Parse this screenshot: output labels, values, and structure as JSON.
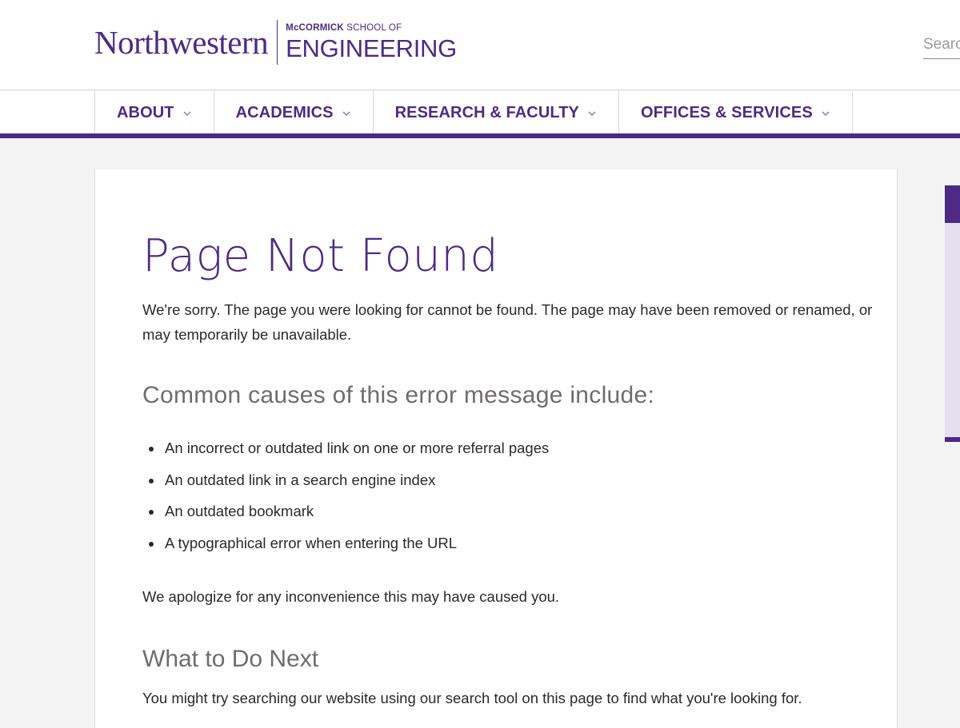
{
  "header": {
    "logo_main": "Northwestern",
    "logo_school_bold": "McCORMICK",
    "logo_school_rest": " SCHOOL OF",
    "logo_school_bottom": "ENGINEERING",
    "search_placeholder": "Search"
  },
  "nav": {
    "items": [
      {
        "label": "ABOUT"
      },
      {
        "label": "ACADEMICS"
      },
      {
        "label": "RESEARCH & FACULTY"
      },
      {
        "label": "OFFICES & SERVICES"
      }
    ]
  },
  "main": {
    "title": "Page Not Found",
    "intro": "We're sorry. The page you were looking for cannot be found. The page may have been removed or renamed, or may temporarily be unavailable.",
    "causes_heading": "Common causes of this error message include:",
    "causes": [
      "An incorrect or outdated link on one or more referral pages",
      "An outdated link in a search engine index",
      "An outdated bookmark",
      "A typographical error when entering the URL"
    ],
    "apology": "We apologize for any inconvenience this may have caused you.",
    "next_heading": "What to Do Next",
    "next_text": "You might try searching our website using our search tool on this page to find what you're looking for."
  },
  "colors": {
    "brand_purple": "#4e2a84",
    "heading_gray": "#716c6b",
    "page_background": "#f3f3f3"
  },
  "icons": {
    "nav_chevron": "chevron-down-icon"
  }
}
